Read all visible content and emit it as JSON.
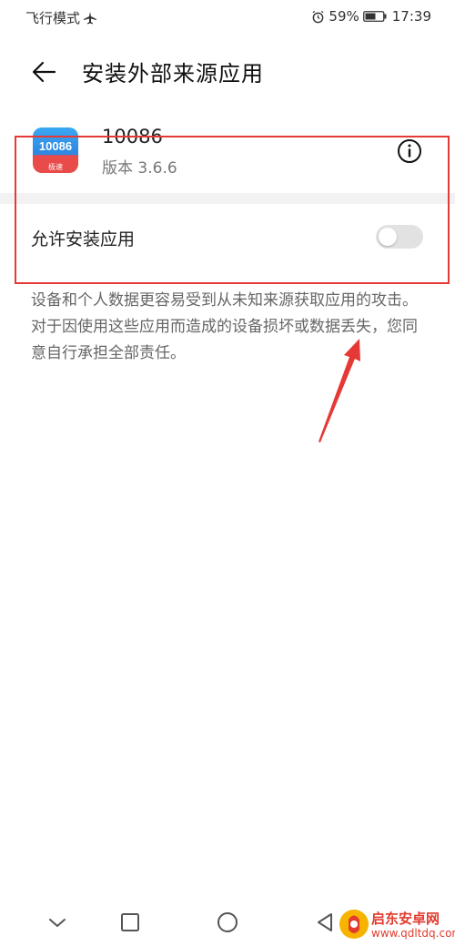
{
  "status_bar": {
    "left_text": "飞行模式",
    "battery_percent": "59%",
    "time": "17:39"
  },
  "header": {
    "title": "安装外部来源应用",
    "back_icon": "arrow-left-icon"
  },
  "app": {
    "name": "10086",
    "version": "版本 3.6.6",
    "icon_text": "10086",
    "icon_sub": "极速",
    "info_icon": "info-icon"
  },
  "setting": {
    "label": "允许安装应用",
    "enabled": false
  },
  "warning": {
    "text": "设备和个人数据更容易受到从未知来源获取应用的攻击。对于因使用这些应用而造成的设备损坏或数据丢失，您同意自行承担全部责任。"
  },
  "navigation": {
    "icons": [
      "chevron-down-icon",
      "square-icon",
      "circle-icon",
      "triangle-back-icon"
    ]
  },
  "watermark": {
    "title": "启东安卓网",
    "url": "www.qdltdq.com"
  },
  "colors": {
    "annotation": "#e53935",
    "toggle_off": "#e2e2e2",
    "watermark": "#e23b2e"
  }
}
